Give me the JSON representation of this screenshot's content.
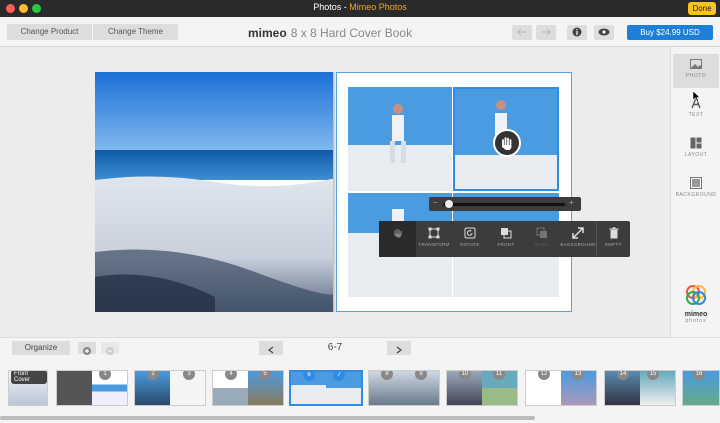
{
  "window": {
    "title_prefix": "Photos - ",
    "title_app": "Mimeo Photos",
    "done_label": "Done"
  },
  "toolbar": {
    "change_product": "Change Product",
    "change_theme": "Change Theme",
    "brand": "mimeo",
    "product_name": "8 x 8 Hard Cover Book",
    "buy_label": "Buy $24.99 USD"
  },
  "sidebar": {
    "tools": [
      {
        "label": "PHOTO",
        "icon": "photo-icon"
      },
      {
        "label": "TEXT",
        "icon": "text-icon"
      },
      {
        "label": "LAYOUT",
        "icon": "layout-icon"
      },
      {
        "label": "BACKGROUND",
        "icon": "background-icon"
      }
    ],
    "logo_text": "mimeo",
    "logo_sub": "photos"
  },
  "popup": {
    "tools": [
      {
        "label": "",
        "icon": "hand-icon"
      },
      {
        "label": "TRANSFORM",
        "icon": "transform-icon"
      },
      {
        "label": "ROTATE",
        "icon": "rotate-icon"
      },
      {
        "label": "FRONT",
        "icon": "front-icon"
      },
      {
        "label": "BACK",
        "icon": "back-icon"
      },
      {
        "label": "BACKGROUND",
        "icon": "expand-icon"
      },
      {
        "label": "EMPTY",
        "icon": "trash-icon"
      }
    ],
    "zoom_minus": "−",
    "zoom_plus": "+",
    "zoom_level": 0.05
  },
  "nav": {
    "organize": "Organize",
    "page_range": "6-7"
  },
  "thumbnails": {
    "front_cover": "Front Cover",
    "pages": [
      "1",
      "2",
      "3",
      "4",
      "5",
      "6",
      "7",
      "8",
      "9",
      "10",
      "11",
      "12",
      "13",
      "14",
      "15",
      "16"
    ]
  },
  "colors": {
    "accent": "#1e7fd8",
    "done": "#f8c51c",
    "title_accent": "#f5a623"
  }
}
